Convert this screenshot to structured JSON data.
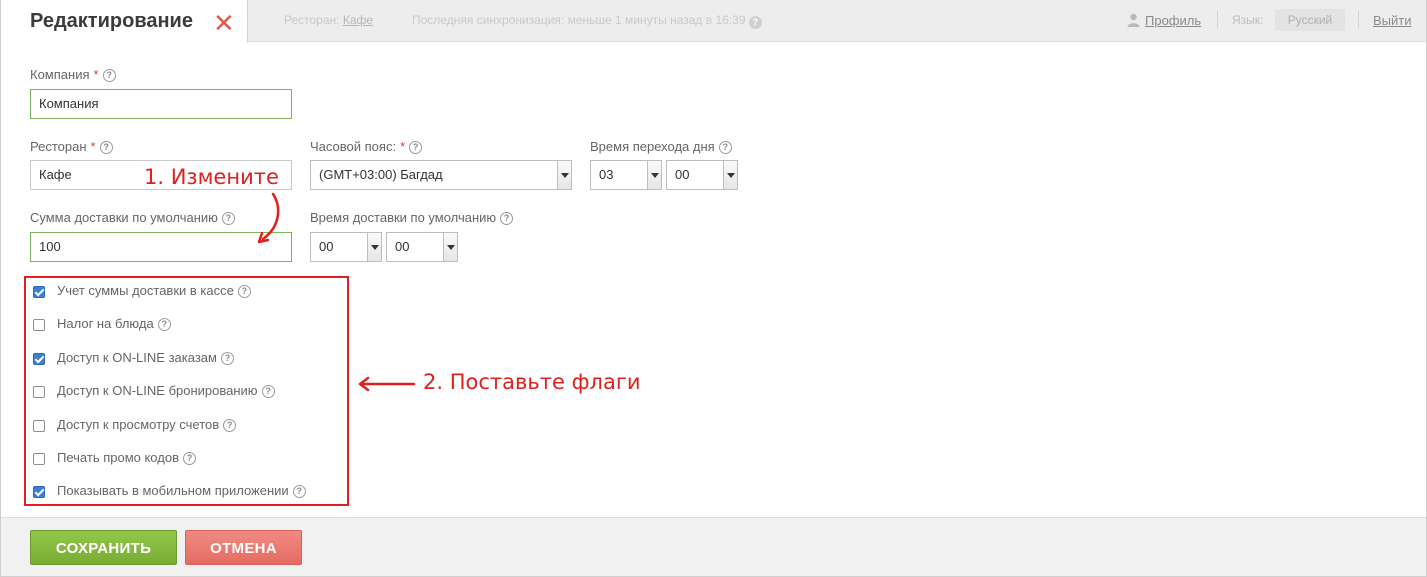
{
  "header": {
    "tab_title": "Редактирование",
    "restaurant_prefix": "Ресторан:",
    "restaurant_link": "Кафе",
    "sync_text": "Последняя синхронизация: меньше 1 минуты назад в 16:39",
    "profile_link": "Профиль",
    "language_label": "Язык:",
    "language_value": "Русский",
    "logout_link": "Выйти"
  },
  "form": {
    "company": {
      "label": "Компания",
      "required": "*",
      "value": "Компания"
    },
    "restaurant": {
      "label": "Ресторан",
      "required": "*",
      "value": "Кафе"
    },
    "timezone": {
      "label": "Часовой пояс:",
      "required": "*",
      "value": "(GMT+03:00) Багдад"
    },
    "day_change": {
      "label": "Время перехода дня",
      "hour": "03",
      "minute": "00"
    },
    "delivery_sum": {
      "label": "Сумма доставки по умолчанию",
      "value": "100"
    },
    "delivery_time": {
      "label": "Время доставки по умолчанию",
      "hour": "00",
      "minute": "00"
    },
    "help_glyph": "?"
  },
  "checkboxes": [
    {
      "label": "Учет суммы доставки в кассе",
      "checked": true
    },
    {
      "label": "Налог на блюда",
      "checked": false
    },
    {
      "label": "Доступ к ON-LINE заказам",
      "checked": true
    },
    {
      "label": "Доступ к ON-LINE бронированию",
      "checked": false
    },
    {
      "label": "Доступ к просмотру счетов",
      "checked": false
    },
    {
      "label": "Печать промо кодов",
      "checked": false
    },
    {
      "label": "Показывать в мобильном  приложении",
      "checked": true
    }
  ],
  "annotations": {
    "step1": "1. Измените",
    "step2": "2. Поставьте флаги"
  },
  "footer": {
    "save_label": "СОХРАНИТЬ",
    "cancel_label": "ОТМЕНА"
  },
  "colors": {
    "accent_red": "#e02020",
    "save_green": "#80b43c",
    "cancel_red": "#ea756c",
    "checkbox_blue": "#3b7fd6"
  }
}
